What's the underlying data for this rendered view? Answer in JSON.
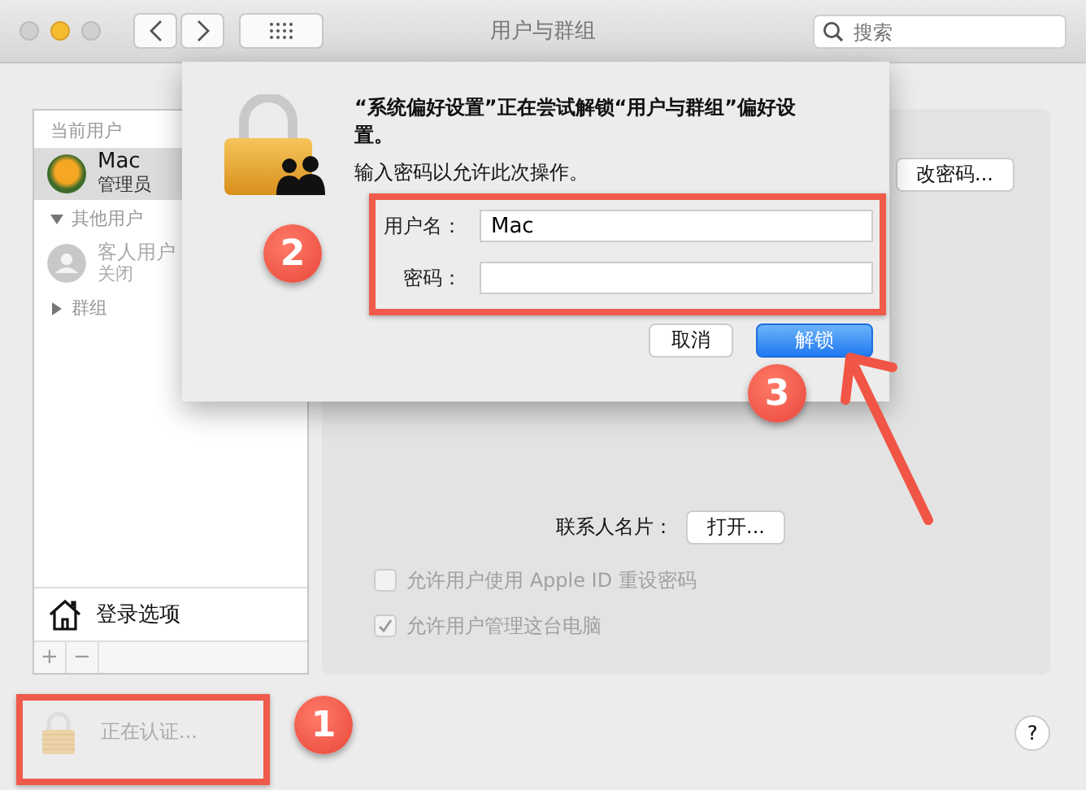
{
  "window": {
    "title": "用户与群组",
    "search": {
      "placeholder": "搜索"
    }
  },
  "sidebar": {
    "current_heading": "当前用户",
    "current_user": {
      "name": "Mac",
      "role": "管理员",
      "selected": true
    },
    "groups": [
      {
        "label": "其他用户",
        "expanded": true,
        "children": [
          {
            "name": "客人用户",
            "status": "关闭",
            "selected": false
          }
        ]
      },
      {
        "label": "群组",
        "expanded": false
      }
    ],
    "login_options": "登录选项",
    "add": "+",
    "remove": "−"
  },
  "panel": {
    "change_password": "改密码...",
    "contact_label": "联系人名片：",
    "contact_button": "打开...",
    "options": [
      {
        "label": "允许用户使用 Apple ID 重设密码",
        "checked": false,
        "disabled": true
      },
      {
        "label": "允许用户管理这台电脑",
        "checked": true,
        "disabled": true
      }
    ]
  },
  "lock_status": "正在认证...",
  "help": "?",
  "dialog": {
    "message": "“系统偏好设置”正在尝试解锁“用户与群组”偏好设置。",
    "prompt": "输入密码以允许此次操作。",
    "fields": [
      {
        "label": "用户名：",
        "value": "Mac",
        "kind": "text"
      },
      {
        "label": "密码：",
        "kind": "password"
      }
    ],
    "buttons": [
      {
        "label": "取消",
        "default": false
      },
      {
        "label": "解锁",
        "default": true
      }
    ]
  },
  "annotations": [
    {
      "number": "1"
    },
    {
      "number": "2"
    },
    {
      "number": "3"
    }
  ]
}
